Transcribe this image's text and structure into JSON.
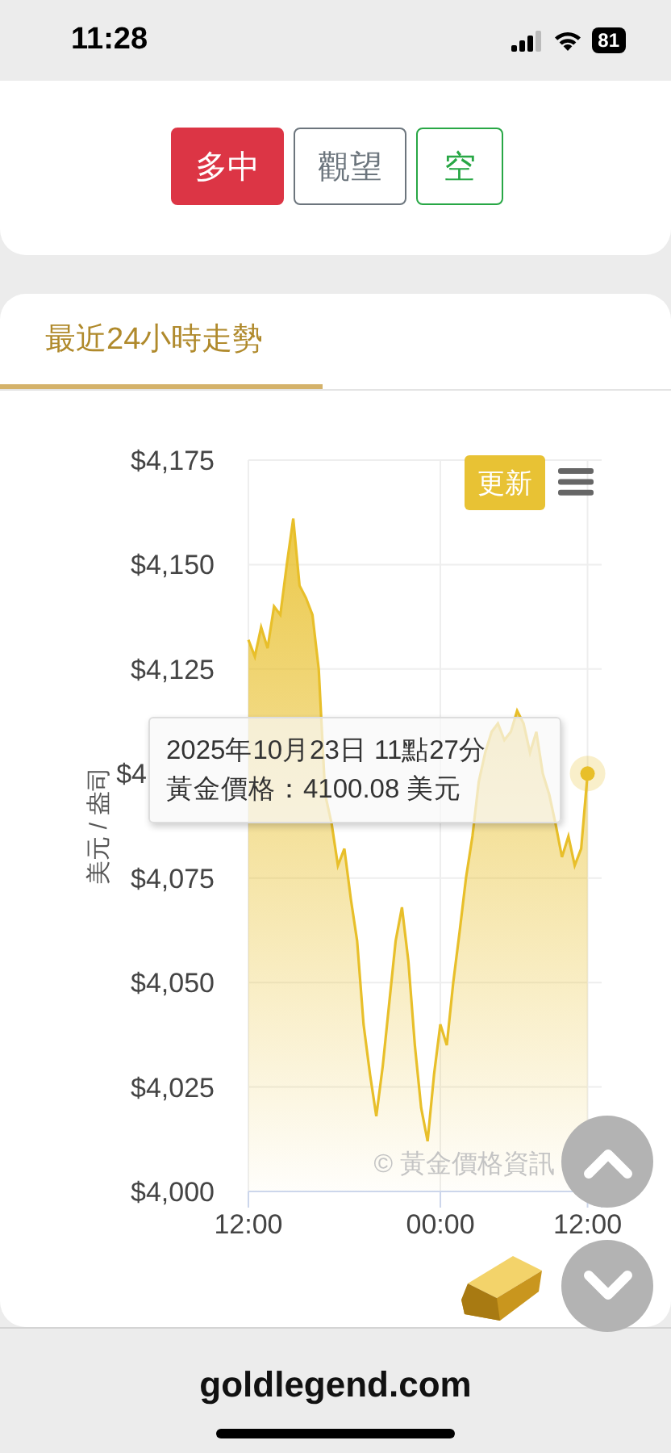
{
  "status_bar": {
    "time": "11:28",
    "battery": "81"
  },
  "signal_buttons": [
    {
      "label": "多中",
      "selected": true,
      "color": "#dc3545"
    },
    {
      "label": "觀望",
      "selected": false,
      "color": "#6c757d"
    },
    {
      "label": "空",
      "selected": false,
      "color": "#28a745"
    }
  ],
  "tabs": [
    {
      "label": "最近24小時走勢",
      "selected": true
    }
  ],
  "chart": {
    "refresh_button": "更新",
    "credits": "© 黃金價格資訊",
    "tooltip": {
      "lines": [
        "2025年10月23日 11點27分",
        "黃金價格：4100.08 美元"
      ]
    },
    "covered_tick_label": "$4",
    "chart_data": {
      "type": "area",
      "ylabel": "美元 / 盎司",
      "grid": true,
      "ylim": [
        4000,
        4175
      ],
      "categories": [
        "12:00",
        null,
        null,
        null,
        null,
        null,
        null,
        null,
        null,
        null,
        null,
        null,
        null,
        null,
        null,
        null,
        null,
        null,
        null,
        null,
        null,
        null,
        null,
        null,
        null,
        null,
        null,
        null,
        null,
        null,
        "00:00",
        null,
        null,
        null,
        null,
        null,
        null,
        null,
        null,
        null,
        null,
        null,
        null,
        null,
        null,
        null,
        null,
        null,
        null,
        null,
        null,
        null,
        null,
        "12:00"
      ],
      "yticks": [
        {
          "value": 4000,
          "label": "$4,000"
        },
        {
          "value": 4025,
          "label": "$4,025"
        },
        {
          "value": 4050,
          "label": "$4,050"
        },
        {
          "value": 4075,
          "label": "$4,075"
        },
        {
          "value": 4125,
          "label": "$4,125"
        },
        {
          "value": 4150,
          "label": "$4,150"
        },
        {
          "value": 4175,
          "label": "$4,175"
        }
      ],
      "series": [
        {
          "color": "#e8bf2a",
          "values": [
            4132,
            4128,
            4135,
            4130,
            4140,
            4138,
            4150,
            4161,
            4145,
            4142,
            4138,
            4125,
            4095,
            4088,
            4078,
            4082,
            4070,
            4060,
            4040,
            4028,
            4018,
            4030,
            4045,
            4060,
            4068,
            4055,
            4035,
            4020,
            4012,
            4028,
            4040,
            4035,
            4050,
            4062,
            4075,
            4085,
            4098,
            4105,
            4110,
            4112,
            4108,
            4110,
            4115,
            4112,
            4105,
            4110,
            4100,
            4095,
            4088,
            4080,
            4085,
            4078,
            4082,
            4100
          ]
        }
      ]
    }
  },
  "footer": {
    "domain": "goldlegend.com"
  }
}
